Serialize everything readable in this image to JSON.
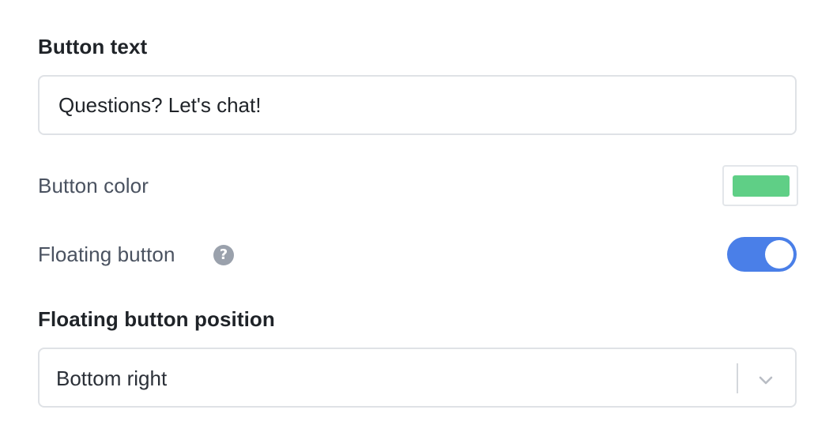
{
  "button_text_field": {
    "label": "Button text",
    "value": "Questions? Let's chat!"
  },
  "button_color": {
    "label": "Button color",
    "swatch_color": "#5fcf86"
  },
  "floating_button": {
    "label": "Floating button",
    "help_icon": "question-circle-icon",
    "help_glyph": "?",
    "enabled": true,
    "toggle_color": "#4a7fe8"
  },
  "floating_position": {
    "label": "Floating button position",
    "selected": "Bottom right",
    "indicator_icon": "chevron-down-icon"
  }
}
